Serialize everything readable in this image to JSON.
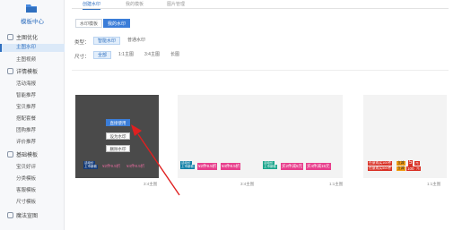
{
  "sidebar": {
    "title": "模板中心",
    "groups": [
      {
        "label": "主图优化",
        "items": [
          "主图水印",
          "主图视频"
        ]
      },
      {
        "label": "详情模板",
        "items": [
          "活动海报",
          "智能推荐",
          "宝贝推荐",
          "搭配套餐",
          "团购推荐",
          "评价推荐"
        ]
      },
      {
        "label": "基础模板",
        "items": [
          "宝贝好评",
          "分类模板",
          "客服模板",
          "尺寸模板"
        ]
      },
      {
        "label": "魔法宣图",
        "items": []
      }
    ],
    "active_item": "主图水印"
  },
  "top_tabs": [
    "创建水印",
    "我的模板",
    "图片管理"
  ],
  "toggle": {
    "left": "水印模板",
    "right": "我的水印"
  },
  "filters": {
    "type_label": "类型：",
    "type_options": [
      "智能水印",
      "普通水印"
    ],
    "size_label": "尺寸：",
    "size_options": [
      "全部",
      "1:1主图",
      "3:4主图",
      "长图"
    ]
  },
  "cards": [
    {
      "caption": "3:4主图",
      "menu": [
        "直接使用",
        "设为水印",
        "删除水印"
      ],
      "watermark": [
        "活动价",
        "上市新款",
        "¥2件9.5折",
        "¥4件8.5折"
      ]
    },
    {
      "caption": "3:4主图",
      "watermark": [
        "活动价",
        "上市新款",
        "¥2件9.5折",
        "¥4件8.5折"
      ]
    },
    {
      "caption": "1:1主图",
      "watermark": [
        "活动价",
        "上市新款",
        "买2件减5元",
        "买4件减15元"
      ]
    },
    {
      "caption": "1:1主图",
      "watermark": [
        "任意购买100件",
        "立减",
        "5",
        "元",
        "任意购买500件",
        "立减",
        "100",
        "元"
      ]
    }
  ],
  "colors": {
    "accent": "#3b7dd8",
    "arrow": "#e02020",
    "watermark_pink": "#e83e8c",
    "watermark_red": "#d93025"
  }
}
